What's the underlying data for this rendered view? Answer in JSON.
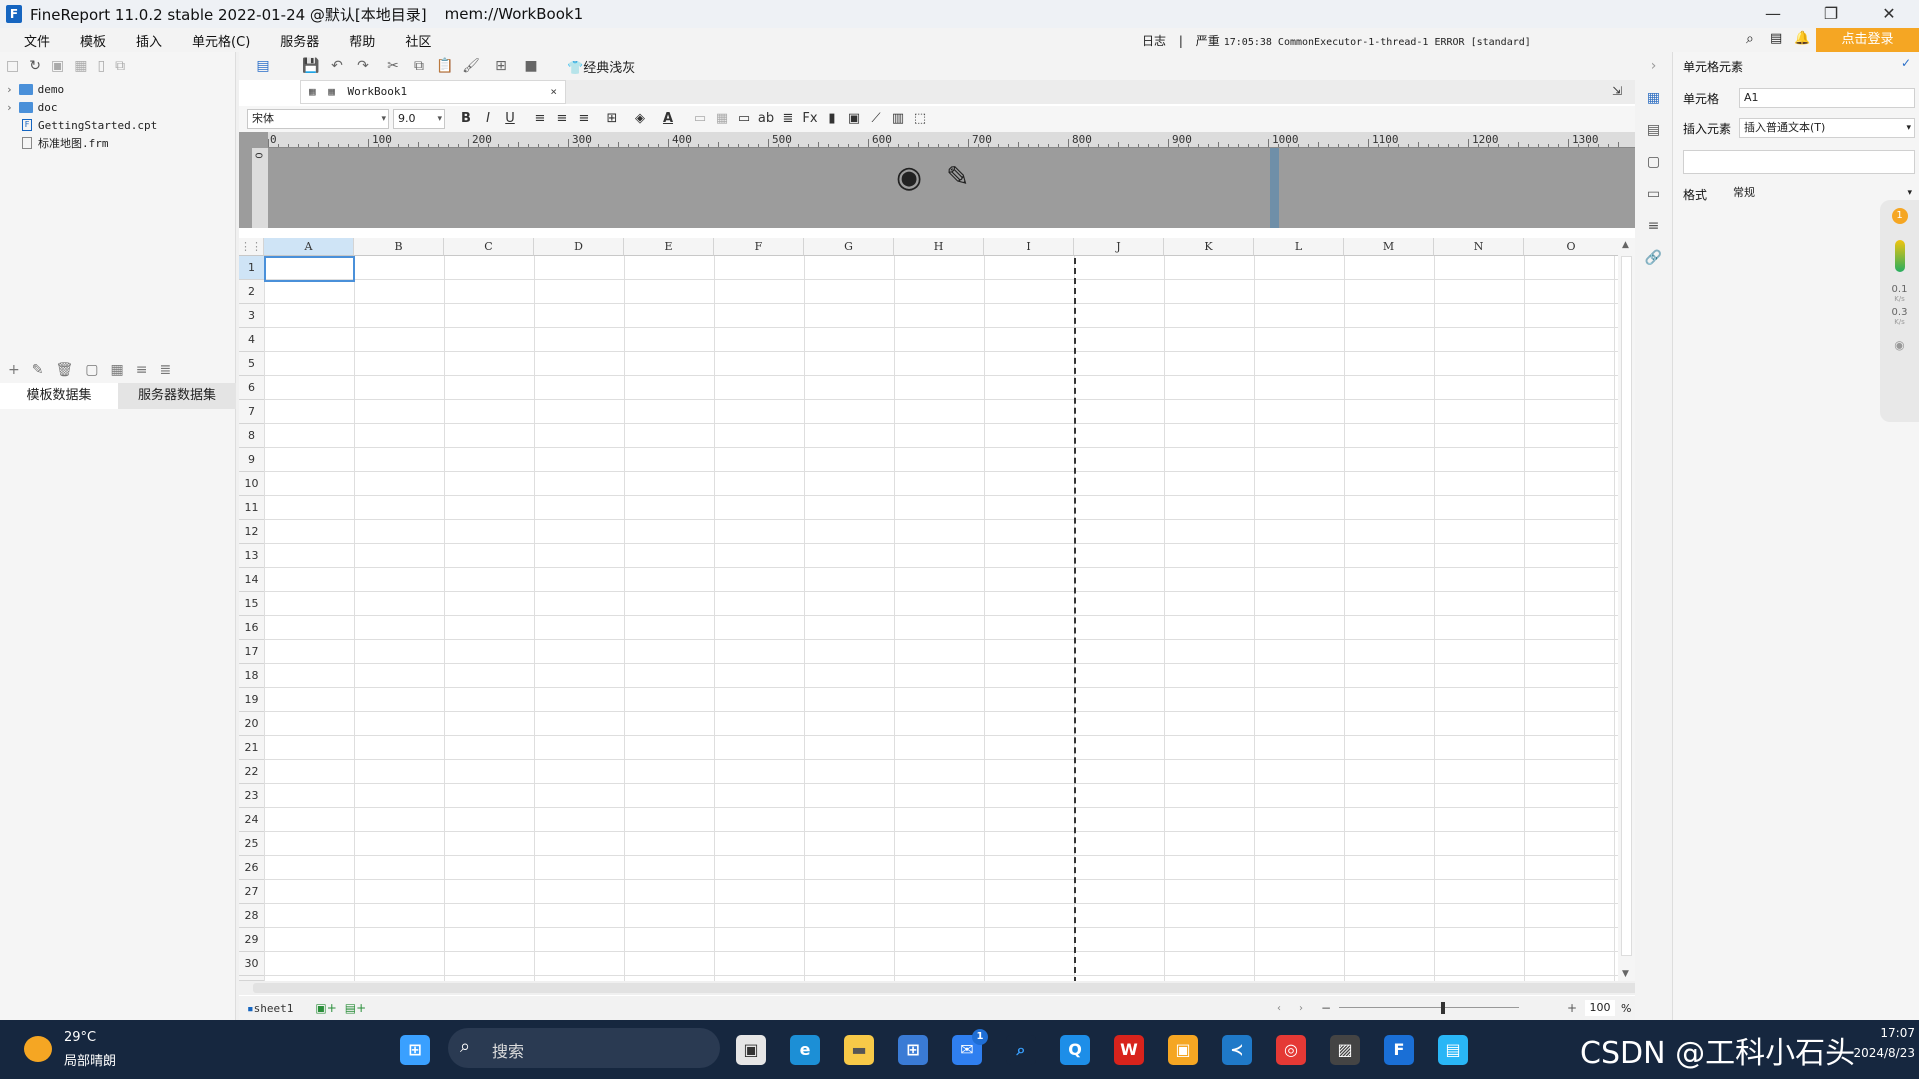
{
  "window": {
    "title": "FineReport 11.0.2 stable 2022-01-24 @默认[本地目录]",
    "path": "mem://WorkBook1",
    "min": "—",
    "max": "❐",
    "close": "✕"
  },
  "menu": [
    "文件",
    "模板",
    "插入",
    "单元格(C)",
    "服务器",
    "帮助",
    "社区"
  ],
  "status": {
    "log_label": "日志",
    "log_sep": "|",
    "severity": "严重",
    "log_text": "17:05:38 CommonExecutor-1-thread-1 ERROR [standard]"
  },
  "login": "点击登录",
  "tree": [
    {
      "name": "demo",
      "type": "folder"
    },
    {
      "name": "doc",
      "type": "folder"
    },
    {
      "name": "GettingStarted.cpt",
      "type": "file"
    },
    {
      "name": "标准地图.frm",
      "type": "file"
    }
  ],
  "dataset_tabs": [
    "模板数据集",
    "服务器数据集"
  ],
  "toolbar": {
    "theme_label": "经典浅灰"
  },
  "workbook_tab": "WorkBook1",
  "format": {
    "font": "宋体",
    "size": "9.0",
    "bold": "B",
    "italic": "I",
    "underline": "U"
  },
  "ruler": {
    "marks": [
      "0",
      "100",
      "200",
      "300",
      "400",
      "500",
      "600",
      "700",
      "800",
      "900",
      "1000",
      "1100",
      "1200",
      "1300"
    ],
    "vmark": "0"
  },
  "grid": {
    "columns": [
      "A",
      "B",
      "C",
      "D",
      "E",
      "F",
      "G",
      "H",
      "I",
      "J",
      "K",
      "L",
      "M",
      "N",
      "O"
    ],
    "rows": [
      "1",
      "2",
      "3",
      "4",
      "5",
      "6",
      "7",
      "8",
      "9",
      "10",
      "11",
      "12",
      "13",
      "14",
      "15",
      "16",
      "17",
      "18",
      "19",
      "20",
      "21",
      "22",
      "23",
      "24",
      "25",
      "26",
      "27",
      "28",
      "29",
      "30"
    ],
    "selected_cell": "A1"
  },
  "sheet": {
    "name": "sheet1",
    "zoom": "100",
    "zoom_unit": "%"
  },
  "right_panel": {
    "header": "单元格元素",
    "cell_label": "单元格",
    "cell_value": "A1",
    "insert_label": "插入元素",
    "insert_value": "插入普通文本(T)",
    "format_label": "格式",
    "format_value": "常规"
  },
  "gadget": {
    "badge": "1",
    "speed1": "0.1",
    "unit1": "K/s",
    "speed2": "0.3",
    "unit2": "K/s"
  },
  "taskbar": {
    "temp": "29°C",
    "weather": "局部晴朗",
    "search": "搜索",
    "mail_badge": "1",
    "time": "17:07",
    "date": "2024/8/23",
    "watermark": "CSDN @工科小石头"
  }
}
